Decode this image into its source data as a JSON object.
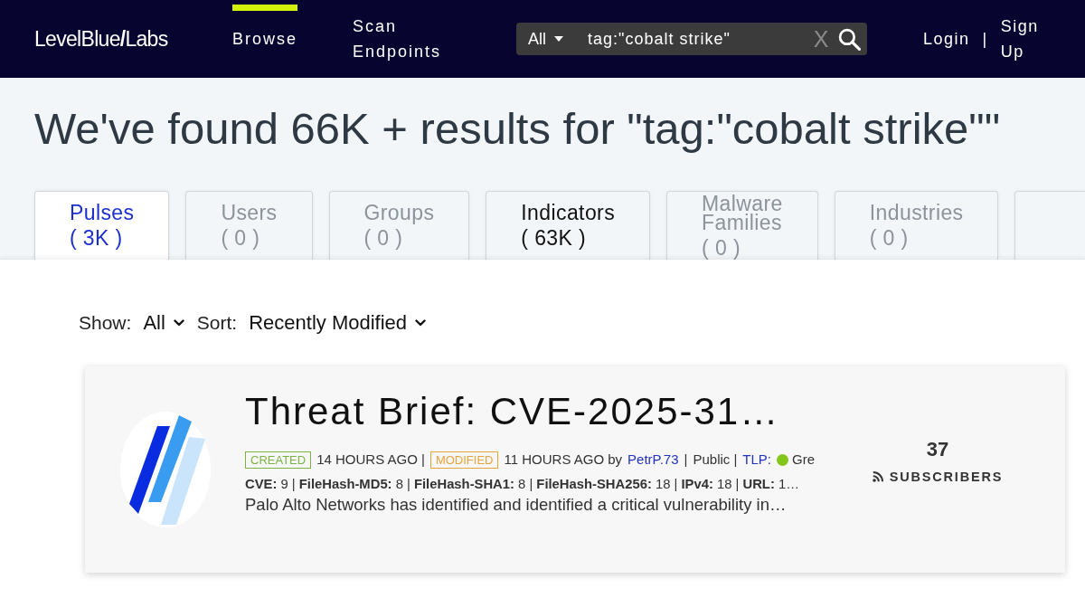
{
  "header": {
    "logo": "LevelBlue**/**Labs",
    "nav": [
      {
        "label": "Browse",
        "selected": true
      },
      {
        "label": "Scan Endpoints",
        "selected": false
      }
    ],
    "search": {
      "scope": "All",
      "value": "tag:\"cobalt strike\"",
      "clear": "X"
    },
    "auth": {
      "login": "Login",
      "separator": "|",
      "signup": "Sign Up"
    }
  },
  "heading": "We've found 66K + results for \"tag:\"cobalt strike\"\"",
  "tabs": [
    {
      "label": "Pulses",
      "count": "( 3K )",
      "selected": true,
      "disabled": false
    },
    {
      "label": "Users",
      "count": "( 0 )",
      "selected": false,
      "disabled": true
    },
    {
      "label": "Groups",
      "count": "( 0 )",
      "selected": false,
      "disabled": true
    },
    {
      "label": "Indicators",
      "count": "( 63K )",
      "selected": false,
      "disabled": false
    },
    {
      "label": "Malware Families",
      "count": "( 0 )",
      "selected": false,
      "disabled": true
    },
    {
      "label": "Industries",
      "count": "( 0 )",
      "selected": false,
      "disabled": true
    },
    {
      "selected": false
    }
  ],
  "filters": [
    {
      "label": "Show:",
      "value": "All"
    },
    {
      "label": "Sort:",
      "value": "Recently Modified"
    }
  ],
  "pulses": [
    {
      "title": "Threat Brief: CVE-2025-31…",
      "meta": [
        {
          "kind": "badge",
          "text": "CREATED",
          "color": "#7cb342"
        },
        {
          "kind": "text",
          "text": "14 HOURS AGO |"
        },
        {
          "kind": "badge",
          "text": "MODIFIED",
          "color": "#e8a33a"
        },
        {
          "kind": "text",
          "text": "11 HOURS AGO by"
        },
        {
          "kind": "link",
          "text": "PetrP.73"
        },
        {
          "kind": "text",
          "text": "|"
        },
        {
          "kind": "text",
          "text": "Public |"
        },
        {
          "kind": "link",
          "text": "TLP:"
        },
        {
          "kind": "dot",
          "color": "#84c51c"
        },
        {
          "kind": "text",
          "text": "Gre"
        }
      ],
      "indicators": "**CVE:** 9 | **FileHash-MD5:** 8 | **FileHash-SHA1:** 8 | **FileHash-SHA256:** 18 | **IPv4:** 18 | **URL:** 1…",
      "description": "Palo Alto Networks has identified and identified a critical vulnerability in…",
      "subscribers": {
        "count": "37",
        "label": "SUBSCRIBERS"
      }
    }
  ]
}
